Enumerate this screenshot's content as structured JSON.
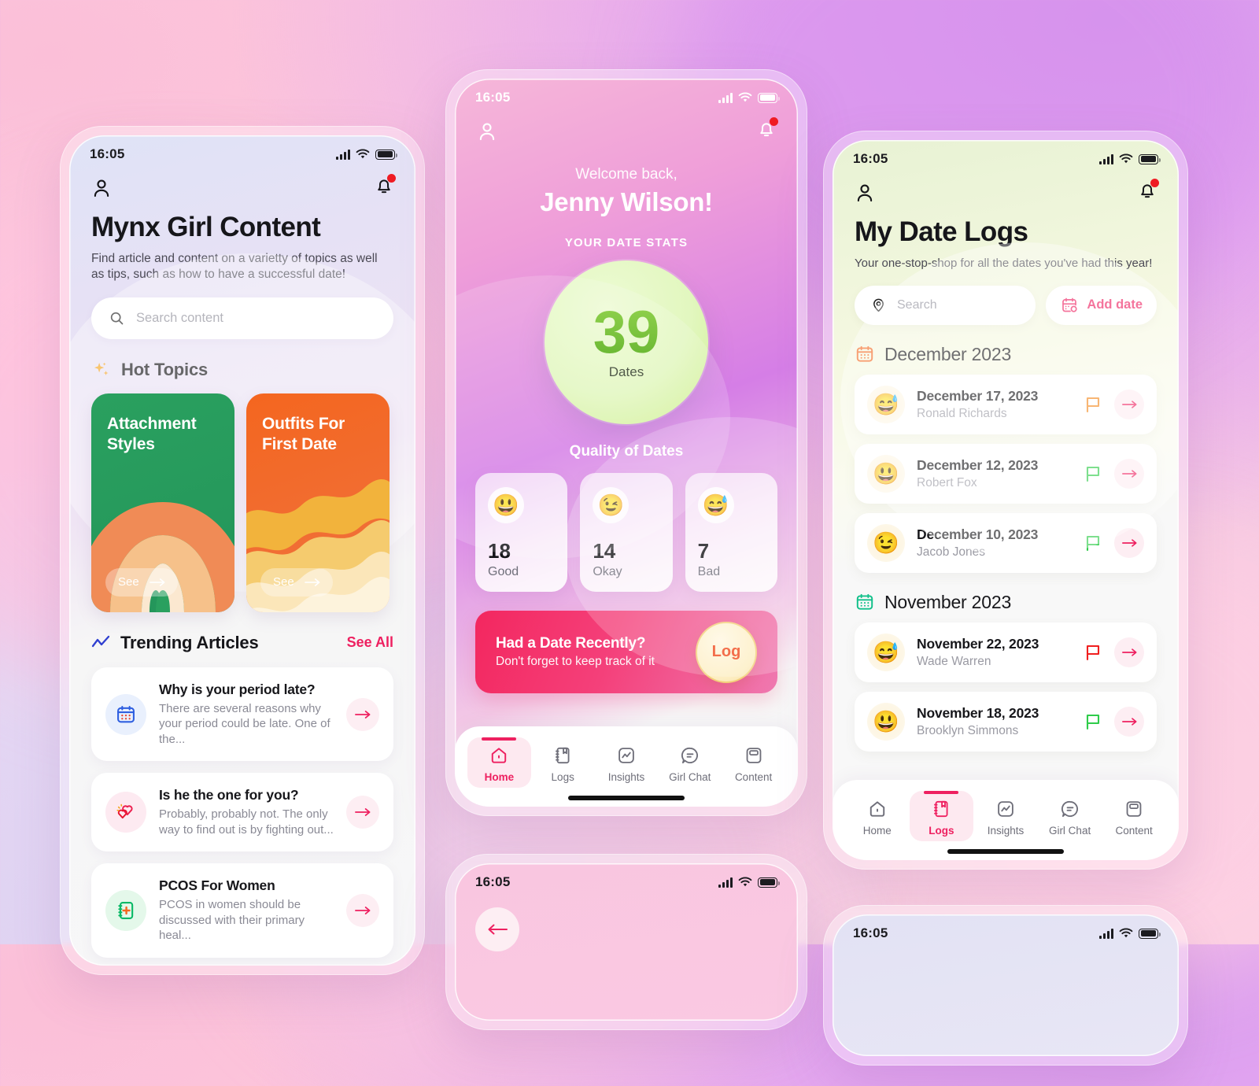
{
  "background": {
    "accent_pink": "#ee2060",
    "accent_green": "#5cbb2a",
    "accent_orange": "#f4661f"
  },
  "phones": {
    "content": {
      "status": {
        "time": "16:05"
      },
      "title": "Mynx Girl Content",
      "subtitle": "Find article and content on a varietty of topics as well as tips, such as how to have a successful date!",
      "search_placeholder": "Search content",
      "hot_topics_label": "Hot Topics",
      "topics": [
        {
          "title": "Attachment Styles",
          "cta": "See",
          "color": "#2aa05f"
        },
        {
          "title": "Outfits For First Date",
          "cta": "See",
          "color": "#f4661f"
        }
      ],
      "trending_label": "Trending Articles",
      "see_all": "See All",
      "articles": [
        {
          "title": "Why is your period late?",
          "desc": "There are several reasons why your period could be late. One of the...",
          "icon": "calendar-icon",
          "icon_bg": "#e9f0fd",
          "icon_color": "#2f5fe0"
        },
        {
          "title": "Is he the one for you?",
          "desc": "Probably, probably not. The only way to find out is by fighting out...",
          "icon": "hearts-icon",
          "icon_bg": "#fdeaf1",
          "icon_color": "#ec1f4f"
        },
        {
          "title": "PCOS For Women",
          "desc": "PCOS in women should be discussed with their primary heal...",
          "icon": "notebook-plus-icon",
          "icon_bg": "#e4f8ea",
          "icon_color": "#08b865"
        }
      ]
    },
    "home": {
      "status": {
        "time": "16:05"
      },
      "welcome_line": "Welcome back,",
      "user_name": "Jenny Wilson!",
      "stats_label": "YOUR DATE STATS",
      "total_dates": "39",
      "total_dates_unit": "Dates",
      "quality_title": "Quality of Dates",
      "quality": [
        {
          "emoji": "😃",
          "value": "18",
          "label": "Good"
        },
        {
          "emoji": "😉",
          "value": "14",
          "label": "Okay"
        },
        {
          "emoji": "😅",
          "value": "7",
          "label": "Bad"
        }
      ],
      "banner": {
        "title": "Had a Date Recently?",
        "subtitle": "Don't forget to keep track of it",
        "button": "Log"
      },
      "nav": [
        {
          "label": "Home",
          "icon": "home-icon",
          "active": true
        },
        {
          "label": "Logs",
          "icon": "book-icon",
          "active": false
        },
        {
          "label": "Insights",
          "icon": "chart-icon",
          "active": false
        },
        {
          "label": "Girl Chat",
          "icon": "chat-icon",
          "active": false
        },
        {
          "label": "Content",
          "icon": "cards-icon",
          "active": false
        }
      ]
    },
    "logs": {
      "status": {
        "time": "16:05"
      },
      "title": "My Date Logs",
      "subtitle": "Your one-stop-shop for all the dates you've had this year!",
      "search_placeholder": "Search",
      "add_date_label": "Add date",
      "groups": [
        {
          "month": "December 2023",
          "icon_color": "#f4661f",
          "entries": [
            {
              "emoji": "😅",
              "date": "December 17, 2023",
              "name": "Ronald Richards",
              "flag": "#f4891f"
            },
            {
              "emoji": "😃",
              "date": "December 12, 2023",
              "name": "Robert Fox",
              "flag": "#2fcc4a"
            },
            {
              "emoji": "😉",
              "date": "December 10, 2023",
              "name": "Jacob Jones",
              "flag": "#2fcc4a"
            }
          ]
        },
        {
          "month": "November 2023",
          "icon_color": "#12c08a",
          "entries": [
            {
              "emoji": "😅",
              "date": "November 22, 2023",
              "name": "Wade Warren",
              "flag": "#f01f1f"
            },
            {
              "emoji": "😃",
              "date": "November 18, 2023",
              "name": "Brooklyn Simmons",
              "flag": "#2fcc4a"
            }
          ]
        }
      ],
      "nav": [
        {
          "label": "Home",
          "icon": "home-icon",
          "active": false
        },
        {
          "label": "Logs",
          "icon": "book-icon",
          "active": true
        },
        {
          "label": "Insights",
          "icon": "chart-icon",
          "active": false
        },
        {
          "label": "Girl Chat",
          "icon": "chat-icon",
          "active": false
        },
        {
          "label": "Content",
          "icon": "cards-icon",
          "active": false
        }
      ]
    },
    "partial_center": {
      "status": {
        "time": "16:05"
      }
    },
    "partial_right": {
      "status": {
        "time": "16:05"
      }
    }
  }
}
